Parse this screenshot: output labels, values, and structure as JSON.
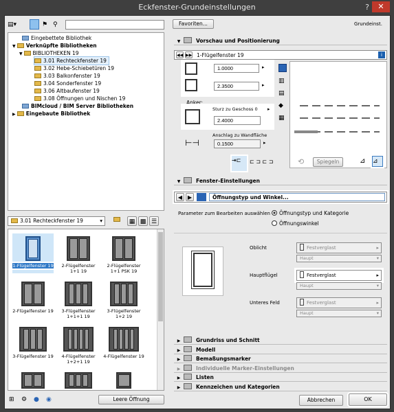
{
  "window": {
    "title": "Eckfenster-Grundeinstellungen",
    "help": "?",
    "close": "✕"
  },
  "toolbar": {
    "search_placeholder": "",
    "favorites": "Favoriten...",
    "mode": "Grundeinst."
  },
  "tree": [
    {
      "label": "Eingebettete Bibliothek",
      "bold": false
    },
    {
      "label": "Verknüpfte Bibliotheken",
      "bold": true
    },
    {
      "label": "BIBLIOTHEKEN 19",
      "bold": false
    },
    {
      "label": "3.01 Rechteckfenster 19",
      "bold": false
    },
    {
      "label": "3.02 Hebe-Schiebetüren 19",
      "bold": false
    },
    {
      "label": "3.03 Balkonfenster 19",
      "bold": false
    },
    {
      "label": "3.04 Sonderfenster 19",
      "bold": false
    },
    {
      "label": "3.06 Altbaufenster 19",
      "bold": false
    },
    {
      "label": "3.08 Öffnungen und Nischen 19",
      "bold": false
    },
    {
      "label": "BIMcloud / BIM Server Bibliotheken",
      "bold": true
    },
    {
      "label": "Eingebaute Bibliothek",
      "bold": true
    }
  ],
  "folder_select": "3.01 Rechteckfenster 19",
  "thumbs": [
    "1-Flügelfenster 19",
    "2-Flügelfenster 1+1 19",
    "2-Flügelfenster 1+1 PSK 19",
    "2-Flügelfenster 19",
    "3-Flügelfenster 1+1+1 19",
    "3-Flügelfenster 1+2 19",
    "3-Flügelfenster 19",
    "4-Flügelfenster 1+2+1 19",
    "4-Flügelfenster 19",
    "",
    "",
    ""
  ],
  "empty_opening": "Leere Öffnung",
  "sections": {
    "preview": "Vorschau und Positionierung",
    "window_settings": "Fenster-Einstellungen",
    "collapsed": [
      "Grundriss und Schnitt",
      "Modell",
      "Bemaßungsmarker",
      "Individuelle Marker-Einstellungen",
      "Listen",
      "Kennzeichen und Kategorien"
    ]
  },
  "preview": {
    "object_name": "1-Flügelfenster 19",
    "width": "1.0000",
    "height": "2.3500",
    "anchor_label": "Anker:",
    "sill_label": "Sturz zu Geschoss 0",
    "sill_value": "2.4000",
    "reveal_label": "Anschlag zu Wandfläche",
    "reveal_value": "0.1500",
    "mirror": "Spiegeln"
  },
  "settings": {
    "page": "Öffnungstyp und Winkel...",
    "param_label": "Parameter zum Bearbeiten auswählen",
    "radio1": "Öffnungstyp und Kategorie",
    "radio2": "Öffnungswinkel",
    "rows": [
      {
        "label": "Oblicht",
        "value": "Festverglast",
        "sub": "Haupt"
      },
      {
        "label": "Hauptflügel",
        "value": "Festverglast",
        "sub": "Haupt"
      },
      {
        "label": "Unteres Feld",
        "value": "Festverglast",
        "sub": "Haupt"
      }
    ]
  },
  "buttons": {
    "cancel": "Abbrechen",
    "ok": "OK"
  }
}
